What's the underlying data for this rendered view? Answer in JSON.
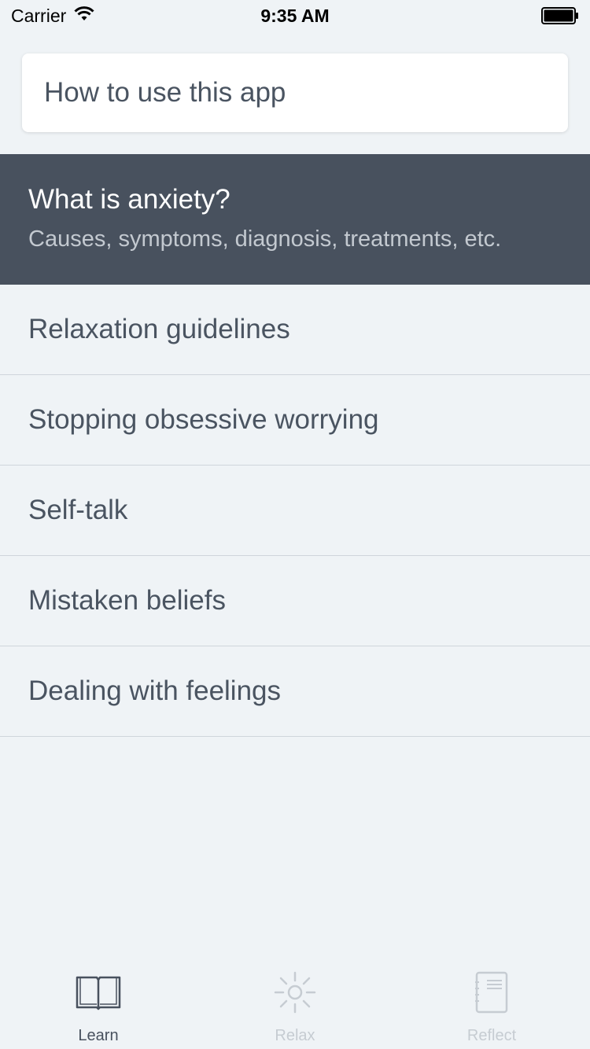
{
  "status_bar": {
    "carrier": "Carrier",
    "time": "9:35 AM"
  },
  "howto": {
    "label": "How to use this app"
  },
  "featured_topic": {
    "title": "What is anxiety?",
    "subtitle": "Causes, symptoms, diagnosis, treatments, etc."
  },
  "topics": [
    {
      "label": "Relaxation guidelines"
    },
    {
      "label": "Stopping obsessive worrying"
    },
    {
      "label": "Self-talk"
    },
    {
      "label": "Mistaken beliefs"
    },
    {
      "label": "Dealing with feelings"
    }
  ],
  "tabs": [
    {
      "label": "Learn",
      "icon": "book-icon",
      "active": true
    },
    {
      "label": "Relax",
      "icon": "sun-icon",
      "active": false
    },
    {
      "label": "Reflect",
      "icon": "notebook-icon",
      "active": false
    }
  ],
  "colors": {
    "background": "#eff3f6",
    "featured_background": "#48515e",
    "text": "#4a5461",
    "tab_inactive": "#c6ccd2"
  }
}
